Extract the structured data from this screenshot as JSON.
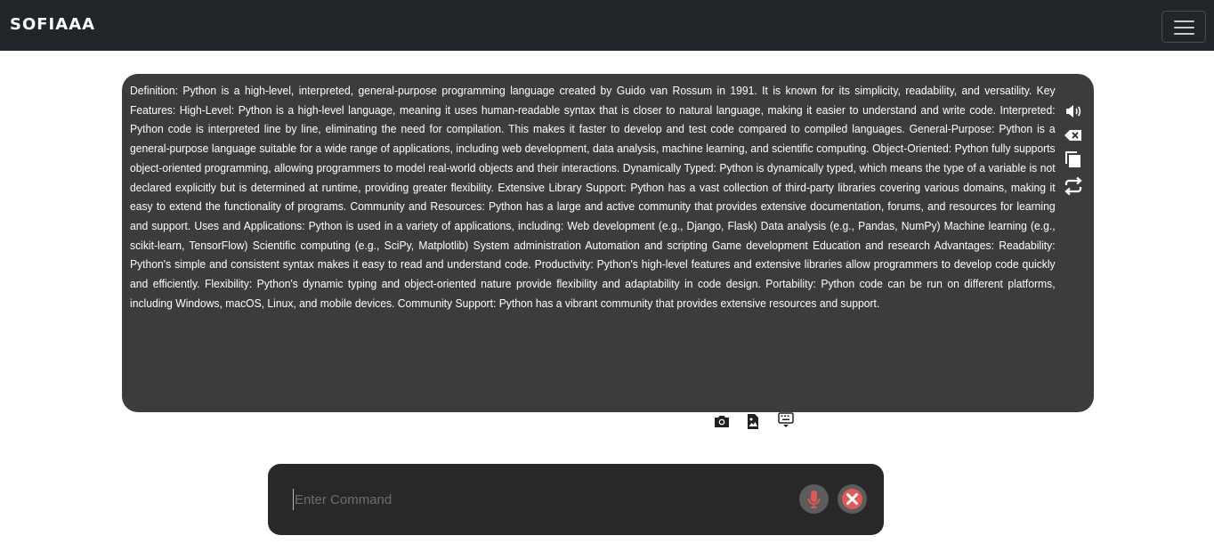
{
  "navbar": {
    "brand": "SOFIAAA",
    "menu_icon": "hamburger-menu-icon"
  },
  "output": {
    "text": "Definition: Python is a high-level, interpreted, general-purpose programming language created by Guido van Rossum in 1991. It is known for its simplicity, readability, and versatility. Key Features: High-Level: Python is a high-level language, meaning it uses human-readable syntax that is closer to natural language, making it easier to understand and write code. Interpreted: Python code is interpreted line by line, eliminating the need for compilation. This makes it faster to develop and test code compared to compiled languages. General-Purpose: Python is a general-purpose language suitable for a wide range of applications, including web development, data analysis, machine learning, and scientific computing. Object-Oriented: Python fully supports object-oriented programming, allowing programmers to model real-world objects and their interactions. Dynamically Typed: Python is dynamically typed, which means the type of a variable is not declared explicitly but is determined at runtime, providing greater flexibility. Extensive Library Support: Python has a vast collection of third-party libraries covering various domains, making it easy to extend the functionality of programs. Community and Resources: Python has a large and active community that provides extensive documentation, forums, and resources for learning and support. Uses and Applications: Python is used in a variety of applications, including: Web development (e.g., Django, Flask) Data analysis (e.g., Pandas, NumPy) Machine learning (e.g., scikit-learn, TensorFlow) Scientific computing (e.g., SciPy, Matplotlib) System administration Automation and scripting Game development Education and research Advantages: Readability: Python's simple and consistent syntax makes it easy to read and understand code. Productivity: Python's high-level features and extensive libraries allow programmers to develop code quickly and efficiently. Flexibility: Python's dynamic typing and object-oriented nature provide flexibility and adaptability in code design. Portability: Python code can be run on different platforms, including Windows, macOS, Linux, and mobile devices. Community Support: Python has a vibrant community that provides extensive resources and support.",
    "side_icons": [
      "speaker-icon",
      "backspace-clear-icon",
      "copy-icon",
      "repeat-icon"
    ]
  },
  "tools": {
    "icons": [
      "camera-icon",
      "image-file-icon",
      "keyboard-icon"
    ]
  },
  "command": {
    "placeholder": "Enter Command",
    "value": "",
    "mic_icon": "microphone-icon",
    "close_icon": "close-icon",
    "mic_color": "#e05a5a",
    "close_color": "#e05a5a"
  }
}
